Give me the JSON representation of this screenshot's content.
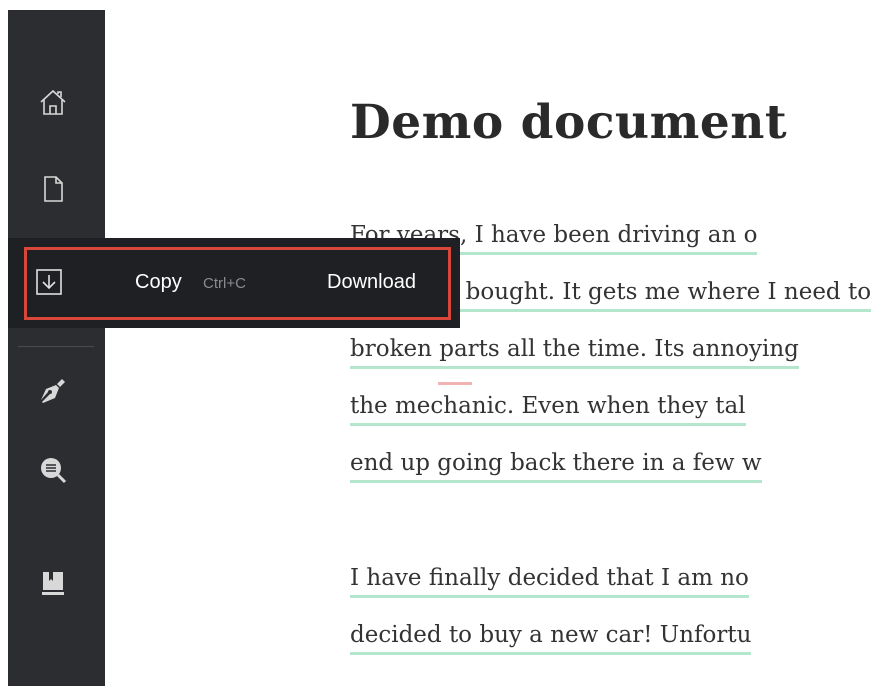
{
  "document": {
    "title": "Demo document",
    "lines": [
      "For years, I have been driving an o",
      "car that I bought. It gets me where I need to",
      "broken parts all the time. Its annoying",
      "the mechanic. Even when they tal",
      "end up going back there in a few w"
    ],
    "paragraph2_lines": [
      "I have finally decided that I am no",
      "decided to buy a new car! Unfortu"
    ]
  },
  "popup": {
    "copy_label": "Copy",
    "copy_shortcut": "Ctrl+C",
    "download_label": "Download"
  },
  "sidebar": {
    "icons": [
      "home-icon",
      "document-icon",
      "download-icon",
      "pen-icon",
      "search-icon",
      "book-icon"
    ]
  },
  "colors": {
    "sidebar_bg": "#2c2d31",
    "popup_bg": "#1f2024",
    "highlight_border": "#d9473b",
    "underline": "#b3e6cc",
    "spelling_mark": "#f2b3b3"
  }
}
